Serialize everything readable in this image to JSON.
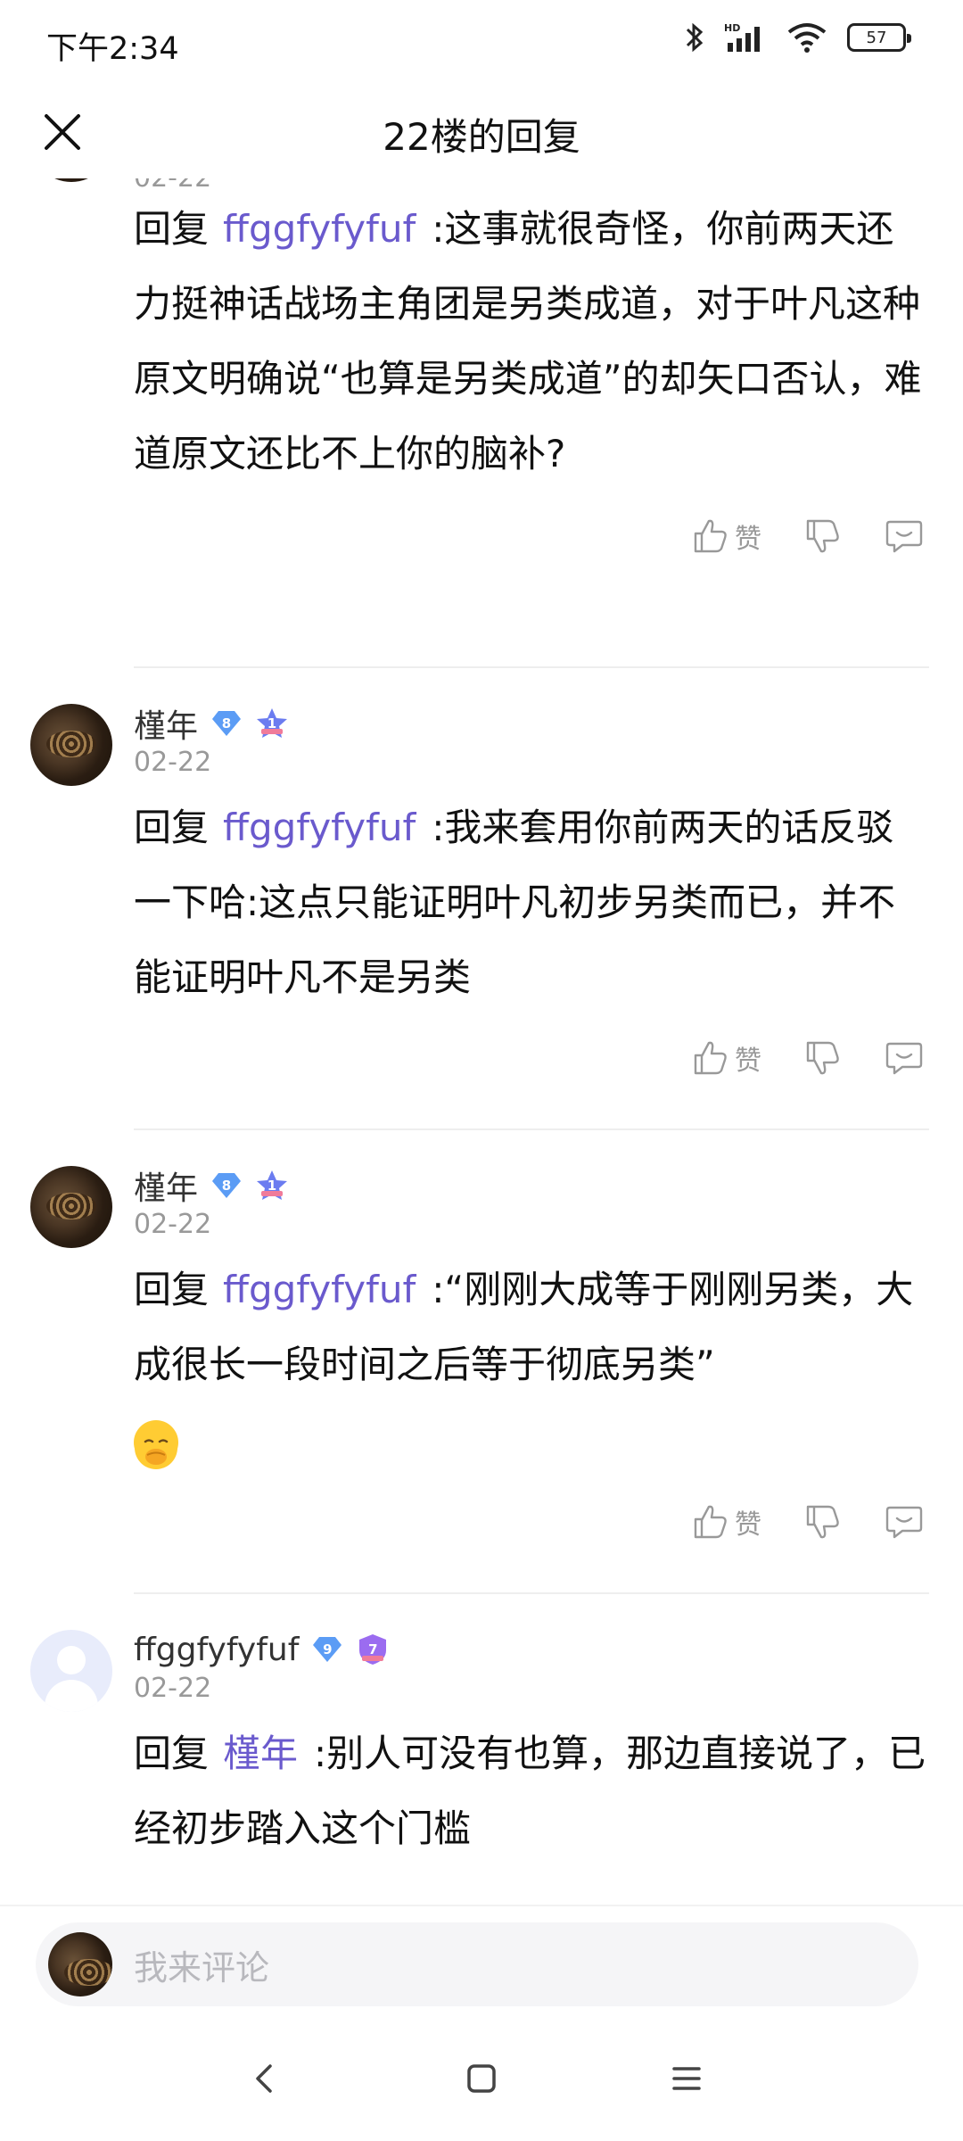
{
  "status_bar": {
    "time": "下午2:34",
    "battery": "57",
    "network": "HD"
  },
  "header": {
    "title": "22楼的回复"
  },
  "action_labels": {
    "like": "赞"
  },
  "comments": [
    {
      "partial": true,
      "date": "02-22",
      "reply_prefix": "回复",
      "reply_target": "ffggfyfyfuf",
      "text": ":这事就很奇怪，你前两天还力挺神话战场主角团是另类成道，对于叶凡这种原文明确说“也算是另类成道”的却矢口否认，难道原文还比不上你的脑补?"
    },
    {
      "username": "槿年",
      "level": "8",
      "medal": "1",
      "date": "02-22",
      "reply_prefix": "回复",
      "reply_target": "ffggfyfyfuf",
      "text": ":我来套用你前两天的话反驳一下哈:这点只能证明叶凡初步另类而已，并不能证明叶凡不是另类"
    },
    {
      "username": "槿年",
      "level": "8",
      "medal": "1",
      "date": "02-22",
      "reply_prefix": "回复",
      "reply_target": "ffggfyfyfuf",
      "text": ":“刚刚大成等于刚刚另类，大成很长一段时间之后等于彻底另类”",
      "emoji": "face-with-hand-over-mouth"
    },
    {
      "username": "ffggfyfyfuf",
      "level": "9",
      "medal": "7",
      "date": "02-22",
      "reply_prefix": "回复",
      "reply_target": "槿年",
      "text": ":别人可没有也算，那边直接说了，已经初步踏入这个门槛"
    }
  ],
  "input": {
    "placeholder": "我来评论"
  },
  "colors": {
    "reply_target": "#6a5acd",
    "level_badge": "#5b9cf5",
    "medal_blue": "#6b7cf0",
    "medal_purple": "#9b6cf0"
  }
}
